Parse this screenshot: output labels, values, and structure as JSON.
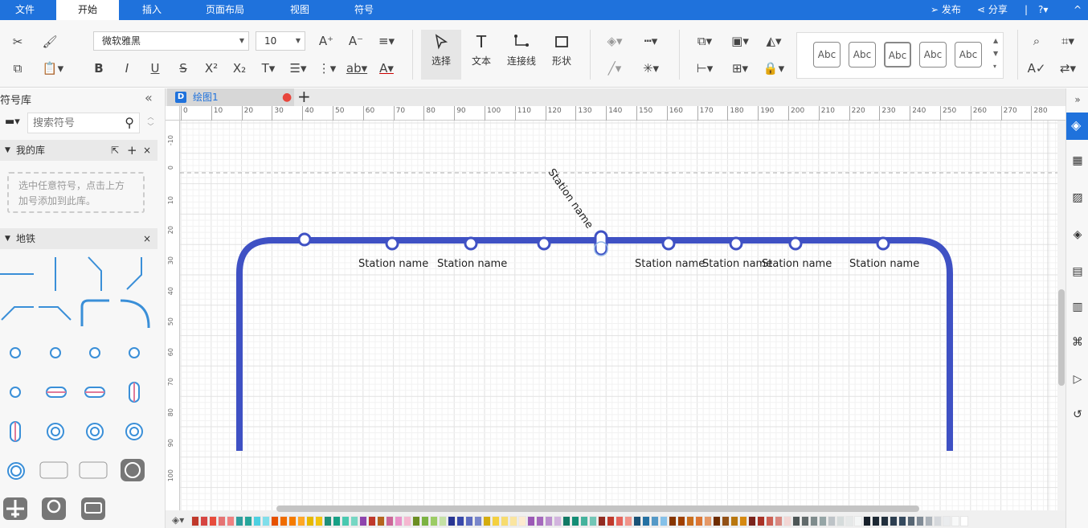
{
  "menubar": {
    "items": [
      "文件",
      "开始",
      "插入",
      "页面布局",
      "视图",
      "符号"
    ],
    "active_index": 1,
    "publish": "发布",
    "share": "分享"
  },
  "ribbon": {
    "font_family": "微软雅黑",
    "font_size": "10",
    "tools": {
      "select": "选择",
      "text": "文本",
      "connector": "连接线",
      "shape": "形状"
    },
    "style_samples": [
      "Abc",
      "Abc",
      "Abc",
      "Abc",
      "Abc"
    ]
  },
  "library": {
    "title": "符号库",
    "search_placeholder": "搜索符号",
    "my_library": "我的库",
    "my_library_hint": "选中任意符号，点击上方加号添加到此库。",
    "subway": "地铁"
  },
  "document": {
    "tab_name": "绘图1",
    "add_tab": "+"
  },
  "rulers": {
    "h_ticks": [
      "0",
      "10",
      "20",
      "30",
      "40",
      "50",
      "60",
      "70",
      "80",
      "90",
      "100",
      "110",
      "120",
      "130",
      "140",
      "150",
      "160",
      "170",
      "180",
      "190",
      "200",
      "210",
      "220",
      "230",
      "240",
      "250",
      "260",
      "270",
      "280"
    ],
    "v_ticks": [
      "-10",
      "0",
      "10",
      "20",
      "30",
      "40",
      "50",
      "60",
      "70",
      "80",
      "90",
      "100"
    ]
  },
  "diagram": {
    "stations": [
      {
        "label": ""
      },
      {
        "label": "Station name"
      },
      {
        "label": "Station name"
      },
      {
        "label": ""
      },
      {
        "label": "Station name"
      },
      {
        "label": "Station name"
      },
      {
        "label": "Station name"
      },
      {
        "label": "Station name"
      },
      {
        "label": "Station name"
      }
    ],
    "line_color": "#3f51c4"
  },
  "colors": {
    "accent": "#1f72dc",
    "unsaved_dot": "#e8453c",
    "palette": [
      "#c0392b",
      "#d64541",
      "#e74c3c",
      "#e57373",
      "#f08080",
      "#2e9e9e",
      "#26a69a",
      "#4dd0e1",
      "#80deea",
      "#e65100",
      "#ef6c00",
      "#f57c00",
      "#ffa726",
      "#e6b800",
      "#f1c40f",
      "#1e8f7a",
      "#16a085",
      "#48c9b0",
      "#76d7c4",
      "#8e44ad",
      "#c0392b",
      "#b5651d",
      "#cc6699",
      "#e991c9",
      "#f5b7d0",
      "#6b8e23",
      "#7cb342",
      "#9ccc65",
      "#c5e1a5",
      "#283593",
      "#3949ab",
      "#5c6bc0",
      "#7986cb",
      "#d4ac0d",
      "#f4d03f",
      "#f7dc6f",
      "#fae5a0",
      "#fdebd0",
      "#9b59b6",
      "#a569bd",
      "#bb8fce",
      "#d2b4de",
      "#117a65",
      "#138d75",
      "#45b39d",
      "#73c6b6",
      "#922b21",
      "#c0392b",
      "#e6645c",
      "#f1948a",
      "#1a5276",
      "#2471a3",
      "#5499c7",
      "#85c1e9",
      "#873600",
      "#a04000",
      "#ca6f1e",
      "#dc7633",
      "#e59866",
      "#6e2c00",
      "#935116",
      "#b9770e",
      "#d68910",
      "#7b241c",
      "#a93226",
      "#cd6155",
      "#d98880",
      "#f2d7d5",
      "#4d5656",
      "#616a6b",
      "#7f8c8d",
      "#95a5a6",
      "#bdc3c7",
      "#d5dbdb",
      "#e5e8e8",
      "#f4f6f6",
      "#17202a",
      "#1c2833",
      "#212f3d",
      "#2c3e50",
      "#34495e",
      "#566573",
      "#808b96",
      "#abb2b9",
      "#d5d8dc",
      "#eaecee",
      "#f8f9f9",
      "#ffffff"
    ]
  }
}
